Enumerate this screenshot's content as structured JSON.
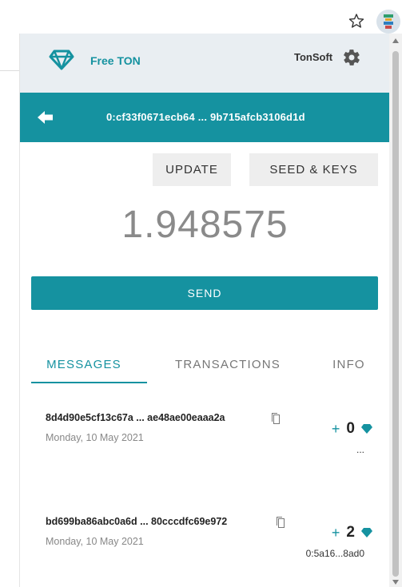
{
  "extension": {
    "brand_name": "Free TON",
    "company": "TonSoft"
  },
  "wallet": {
    "address": "0:cf33f0671ecb64 ... 9b715afcb3106d1d",
    "balance": "1.948575"
  },
  "actions": {
    "update_label": "UPDATE",
    "seed_label": "SEED & KEYS",
    "send_label": "SEND"
  },
  "tabs": [
    {
      "label": "MESSAGES",
      "active": true
    },
    {
      "label": "TRANSACTIONS",
      "active": false
    },
    {
      "label": "INFO",
      "active": false
    }
  ],
  "messages": [
    {
      "hash": "8d4d90e5cf13c67a ... ae48ae00eaaa2a",
      "date": "Monday, 10 May 2021",
      "sign": "+",
      "amount": "0",
      "counterparty": "..."
    },
    {
      "hash": "bd699ba86abc0a6d ... 80cccdfc69e972",
      "date": "Monday, 10 May 2021",
      "sign": "+",
      "amount": "2",
      "counterparty": "0:5a16...8ad0"
    }
  ],
  "colors": {
    "accent": "#1592a0",
    "header_bg": "#e9eef2",
    "button_bg": "#eeeeee"
  },
  "icons": [
    "star-icon",
    "extension-icon",
    "diamond-logo-icon",
    "gear-icon",
    "back-arrow-icon",
    "copy-icon",
    "gem-icon"
  ]
}
